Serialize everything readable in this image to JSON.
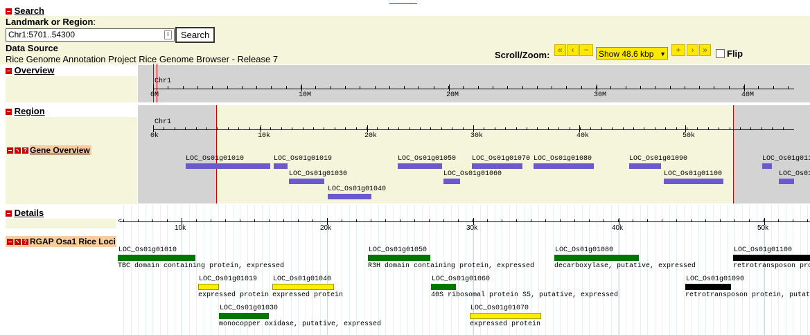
{
  "search": {
    "section_title": "Search",
    "landmark_label": "Landmark or Region",
    "landmark_suffix": ":",
    "landmark_value": "Chr1:5701..54300",
    "search_button": "Search",
    "data_source_label": "Data Source",
    "data_source_value": "Rice Genome Annotation Project Rice Genome Browser - Release 7"
  },
  "scroll_zoom": {
    "label": "Scroll/Zoom:",
    "zoom_select": "Show 48.6 kbp",
    "flip_label": "Flip",
    "buttons": [
      "<<",
      "<",
      "-",
      "+",
      ">",
      ">>"
    ]
  },
  "overview": {
    "title": "Overview",
    "chrom": "Chr1",
    "ticks": [
      "0M",
      "10M",
      "20M",
      "30M",
      "40M"
    ]
  },
  "region": {
    "title": "Region",
    "chrom": "Chr1",
    "ticks": [
      "0k",
      "10k",
      "20k",
      "30k",
      "40k",
      "50k"
    ],
    "track_title": "Gene Overview",
    "genes": [
      {
        "name": "LOC_Os01g01010"
      },
      {
        "name": "LOC_Os01g01019"
      },
      {
        "name": "LOC_Os01g01030"
      },
      {
        "name": "LOC_Os01g01040"
      },
      {
        "name": "LOC_Os01g01050"
      },
      {
        "name": "LOC_Os01g01060"
      },
      {
        "name": "LOC_Os01g01070"
      },
      {
        "name": "LOC_Os01g01080"
      },
      {
        "name": "LOC_Os01g01090"
      },
      {
        "name": "LOC_Os01g01100"
      },
      {
        "name": "LOC_Os01g011"
      },
      {
        "name": "LOC_Os01"
      }
    ]
  },
  "details": {
    "title": "Details",
    "ticks": [
      "10k",
      "20k",
      "30k",
      "40k",
      "50k"
    ],
    "track_title": "RGAP Osa1 Rice Loci",
    "loci": [
      {
        "name": "LOC_Os01g01010",
        "desc": "TBC domain containing protein, expressed",
        "color": "#007700"
      },
      {
        "name": "LOC_Os01g01019",
        "desc": "expressed protein",
        "color": "#ffee00"
      },
      {
        "name": "LOC_Os01g01040",
        "desc": "expressed protein",
        "color": "#ffee00"
      },
      {
        "name": "LOC_Os01g01030",
        "desc": "monocopper oxidase, putative, expressed",
        "color": "#007700"
      },
      {
        "name": "LOC_Os01g01050",
        "desc": "R3H domain containing protein, expressed",
        "color": "#007700"
      },
      {
        "name": "LOC_Os01g01060",
        "desc": "40S ribosomal protein S5, putative, expressed",
        "color": "#007700"
      },
      {
        "name": "LOC_Os01g01070",
        "desc": "expressed protein",
        "color": "#ffee00"
      },
      {
        "name": "LOC_Os01g01080",
        "desc": "decarboxylase, putative, expressed",
        "color": "#007700"
      },
      {
        "name": "LOC_Os01g01090",
        "desc": "retrotransposon protein, putat",
        "color": "#000000"
      },
      {
        "name": "LOC_Os01g01100",
        "desc": "retrotransposon pro",
        "color": "#000000"
      }
    ]
  },
  "colors": {
    "panel_bg": "#f5f5dc",
    "gene_bar": "#6a5acd",
    "highlight_line": "#cc0000",
    "grey_out": "#d3d3d3"
  }
}
